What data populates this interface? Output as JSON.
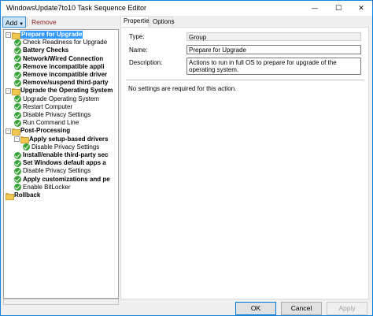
{
  "window": {
    "title": "WindowsUpdate7to10 Task Sequence Editor"
  },
  "titlebar_glyphs": {
    "minimize": "—",
    "maximize": "☐",
    "close": "✕"
  },
  "toolbar": {
    "add_label": "Add",
    "add_caret": "▼",
    "remove_label": "Remove"
  },
  "tree": [
    {
      "label": "Prepare for Upgrade",
      "kind": "group",
      "bold": true,
      "selected": true,
      "level": 0,
      "expander": "-"
    },
    {
      "label": "Check Readiness for Upgrade",
      "kind": "step",
      "bold": false,
      "level": 1
    },
    {
      "label": "Battery Checks",
      "kind": "step",
      "bold": true,
      "level": 1
    },
    {
      "label": "Network/Wired Connection",
      "kind": "step",
      "bold": true,
      "level": 1
    },
    {
      "label": "Remove incompatible appli",
      "kind": "step",
      "bold": true,
      "level": 1
    },
    {
      "label": "Remove incompatible driver",
      "kind": "step",
      "bold": true,
      "level": 1
    },
    {
      "label": "Remove/suspend third-party",
      "kind": "step",
      "bold": true,
      "level": 1
    },
    {
      "label": "Upgrade the Operating System",
      "kind": "group",
      "bold": true,
      "level": 0,
      "expander": "-"
    },
    {
      "label": "Upgrade Operating System",
      "kind": "step",
      "bold": false,
      "level": 1
    },
    {
      "label": "Restart Computer",
      "kind": "step",
      "bold": false,
      "level": 1
    },
    {
      "label": "Disable Privacy Settings",
      "kind": "step",
      "bold": false,
      "level": 1
    },
    {
      "label": "Run Command Line",
      "kind": "step",
      "bold": false,
      "level": 1
    },
    {
      "label": "Post-Processing",
      "kind": "group",
      "bold": true,
      "level": 0,
      "expander": "-"
    },
    {
      "label": "Apply setup-based drivers",
      "kind": "group",
      "bold": true,
      "level": 1,
      "expander": "-"
    },
    {
      "label": "Disable Privacy Settings",
      "kind": "step",
      "bold": false,
      "level": 2
    },
    {
      "label": "Install/enable third-party sec",
      "kind": "step",
      "bold": true,
      "level": 1
    },
    {
      "label": "Set Windows default apps a",
      "kind": "step",
      "bold": true,
      "level": 1
    },
    {
      "label": "Disable Privacy Settings",
      "kind": "step",
      "bold": false,
      "level": 1
    },
    {
      "label": "Apply customizations and pe",
      "kind": "step",
      "bold": true,
      "level": 1
    },
    {
      "label": "Enable BitLocker",
      "kind": "step",
      "bold": false,
      "level": 1
    },
    {
      "label": "Rollback",
      "kind": "group",
      "bold": true,
      "level": 0
    }
  ],
  "tabs": {
    "properties": "Properties",
    "options": "Options"
  },
  "properties": {
    "type_label": "Type:",
    "type_value": "Group",
    "name_label": "Name:",
    "name_value": "Prepare for Upgrade",
    "description_label": "Description:",
    "description_value": "Actions to run in full OS to prepare for upgrade of the operating system.",
    "note": "No settings are required  for this action."
  },
  "buttons": {
    "ok": "OK",
    "cancel": "Cancel",
    "apply": "Apply"
  }
}
